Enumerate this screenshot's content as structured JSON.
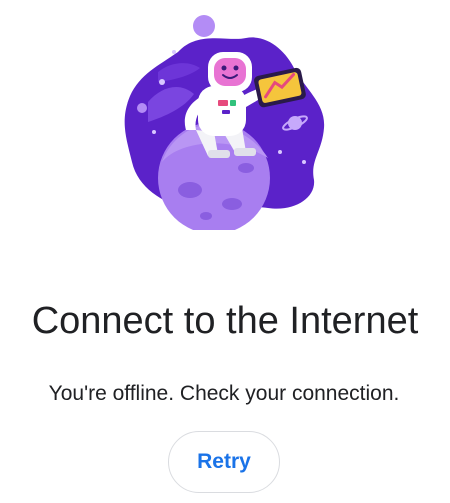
{
  "offline": {
    "title": "Connect to the Internet",
    "message": "You're offline. Check your connection.",
    "retry_label": "Retry",
    "illustration_icon": "astronaut-on-planet-icon"
  },
  "colors": {
    "text": "#202124",
    "accent": "#1a73e8",
    "button_border": "#dadce0",
    "illustration_purple_dark": "#5b22c9",
    "illustration_purple_light": "#a87ef0"
  }
}
